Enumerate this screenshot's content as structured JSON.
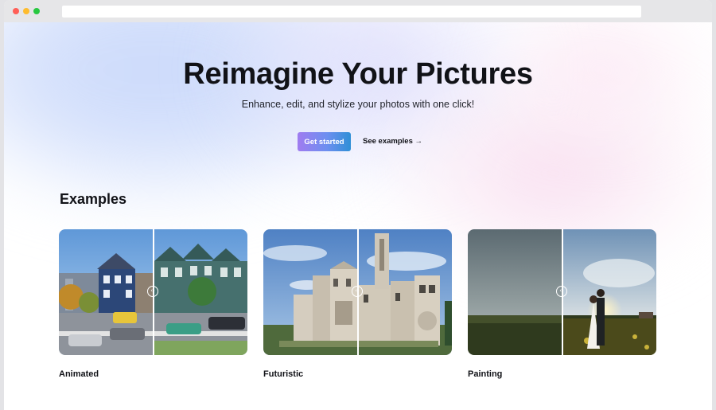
{
  "hero": {
    "title": "Reimagine Your Pictures",
    "subtitle": "Enhance, edit, and stylize your photos with one click!",
    "primary_button": "Get started",
    "secondary_link": "See examples →"
  },
  "examples": {
    "heading": "Examples",
    "cards": [
      {
        "label": "Animated",
        "icon": "compare-slider-handle"
      },
      {
        "label": "Futuristic",
        "icon": "compare-slider-handle"
      },
      {
        "label": "Painting",
        "icon": "compare-slider-handle"
      }
    ]
  },
  "colors": {
    "button_gradient_start": "#a07cf0",
    "button_gradient_end": "#2f8fd6",
    "text": "#111217"
  }
}
